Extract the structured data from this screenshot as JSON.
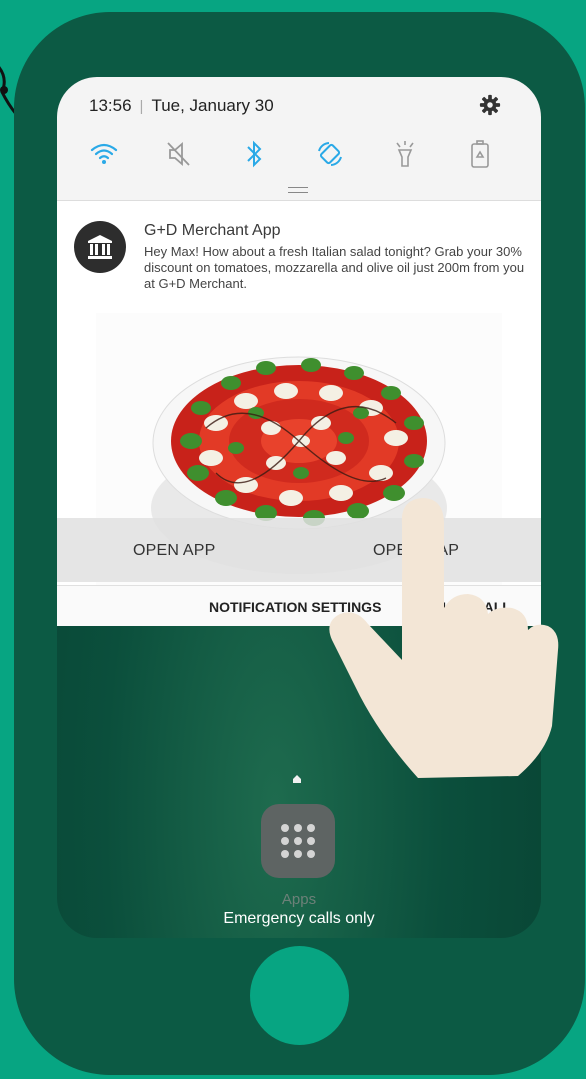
{
  "status_bar": {
    "time": "13:56",
    "separator": "|",
    "date": "Tue, January 30"
  },
  "quick_settings": [
    "wifi-icon",
    "mute-icon",
    "bluetooth-icon",
    "auto-rotate-icon",
    "flashlight-icon",
    "power-saving-icon"
  ],
  "notification": {
    "app_name": "G+D Merchant App",
    "message": "Hey Max! How about a fresh Italian salad tonight? Grab your 30% discount on tomatoes, mozzarella and olive oil just 200m from you at G+D Merchant.",
    "image": "caprese-salad-image",
    "actions": {
      "open_app": "OPEN APP",
      "open_map": "OPEN MAP"
    }
  },
  "footer": {
    "settings": "NOTIFICATION SETTINGS",
    "clear": "CLEAR ALL"
  },
  "lock_screen": {
    "apps_label": "Apps",
    "emergency": "Emergency calls only"
  },
  "colors": {
    "background": "#07a582",
    "phone": "#0c5a44",
    "accent_blue": "#2aa9e7",
    "hand": "#f3e6d6"
  }
}
